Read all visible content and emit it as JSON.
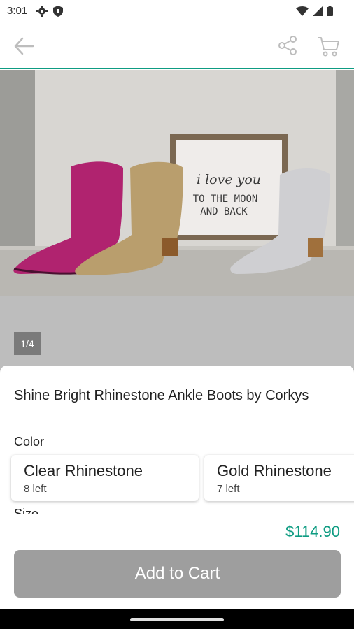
{
  "status_bar": {
    "time": "3:01",
    "icons": [
      "gear-icon",
      "shield-icon",
      "wifi-icon",
      "cellular-signal-icon",
      "battery-icon"
    ]
  },
  "app_bar": {
    "icons": [
      "back-arrow-icon",
      "share-icon",
      "cart-icon"
    ]
  },
  "gallery": {
    "image_sign_line1": "i love you",
    "image_sign_line2": "TO THE MOON",
    "image_sign_line3": "AND BACK",
    "page_indicator": "1/4"
  },
  "product": {
    "title": "Shine Bright Rhinestone Ankle Boots by Corkys",
    "color_label": "Color",
    "color_options": [
      {
        "name": "Clear Rhinestone",
        "stock": "8 left"
      },
      {
        "name": "Gold Rhinestone",
        "stock": "7 left"
      }
    ],
    "size_label": "Size"
  },
  "purchase": {
    "price": "$114.90",
    "add_to_cart_label": "Add to Cart"
  },
  "colors": {
    "accent": "#0e9c82",
    "button_disabled": "#9e9e9e"
  }
}
